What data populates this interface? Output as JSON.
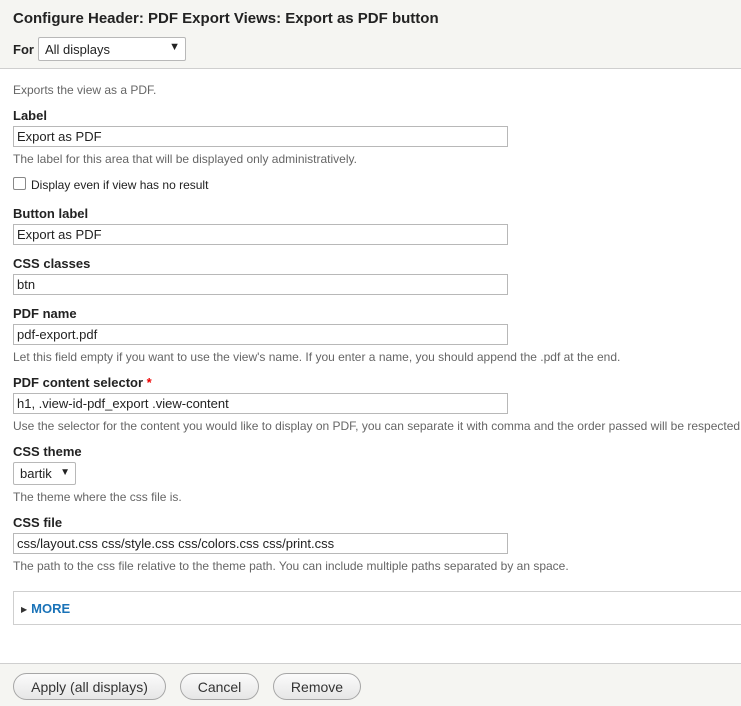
{
  "header": {
    "title": "Configure Header: PDF Export Views: Export as PDF button",
    "for_label": "For",
    "for_select_value": "All displays",
    "dropdown_arrow": "▼"
  },
  "form": {
    "intro": "Exports the view as a PDF.",
    "label": {
      "title": "Label",
      "value": "Export as PDF",
      "description": "The label for this area that will be displayed only administratively."
    },
    "display_even_empty": {
      "label": "Display even if view has no result",
      "checked": false
    },
    "button_label": {
      "title": "Button label",
      "value": "Export as PDF"
    },
    "css_classes": {
      "title": "CSS classes",
      "value": "btn"
    },
    "pdf_name": {
      "title": "PDF name",
      "value": "pdf-export.pdf",
      "description": "Let this field empty if you want to use the view's name. If you enter a name, you should append the .pdf at the end."
    },
    "pdf_content_selector": {
      "title": "PDF content selector",
      "required_mark": "*",
      "value": "h1, .view-id-pdf_export .view-content",
      "description": "Use the selector for the content you would like to display on PDF, you can separate it with comma and the order passed will be respected."
    },
    "css_theme": {
      "title": "CSS theme",
      "value": "bartik",
      "description": "The theme where the css file is."
    },
    "css_file": {
      "title": "CSS file",
      "value": "css/layout.css css/style.css css/colors.css css/print.css",
      "description": "The path to the css file relative to the theme path. You can include multiple paths separated by an space."
    },
    "more": {
      "label": "MORE",
      "triangle": "▶"
    }
  },
  "footer": {
    "apply_label": "Apply (all displays)",
    "cancel_label": "Cancel",
    "remove_label": "Remove"
  },
  "colors": {
    "link": "#1a73b8",
    "required": "#e00000",
    "bar_background": "#f5f5f2"
  }
}
